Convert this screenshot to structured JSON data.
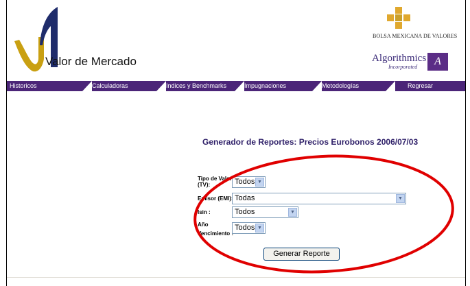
{
  "header": {
    "brand": "Valor de Mercado",
    "bmv": "BOLSA MEXICANA DE VALORES",
    "partner_name": "Algorithmics",
    "partner_sub": "Incorporated"
  },
  "nav": [
    {
      "label": "Historicos"
    },
    {
      "label": "Calculadoras"
    },
    {
      "label": "Indices y Benchmarks"
    },
    {
      "label": "Impugnaciones"
    },
    {
      "label": "Metodologías"
    },
    {
      "label": "Regresar"
    }
  ],
  "report": {
    "title": "Generador de Reportes: Precios Eurobonos 2006/07/03"
  },
  "form": {
    "tipo_label_1": "Tipo de Valor",
    "tipo_label_2": "(TV):",
    "tipo_value": "Todos",
    "emisor_label": "Emisor (EMI):",
    "emisor_value": "Todas",
    "isin_label": "Isin :",
    "isin_value": "Todos",
    "anio_label_1": "Año",
    "anio_label_2": "Vencimiento :",
    "anio_value": "Todos",
    "submit": "Generar Reporte"
  },
  "colors": {
    "nav_bg": "#4b2578",
    "logo_gold": "#c9a012",
    "logo_navy": "#1f2c6b",
    "annotation_red": "#e00000"
  }
}
